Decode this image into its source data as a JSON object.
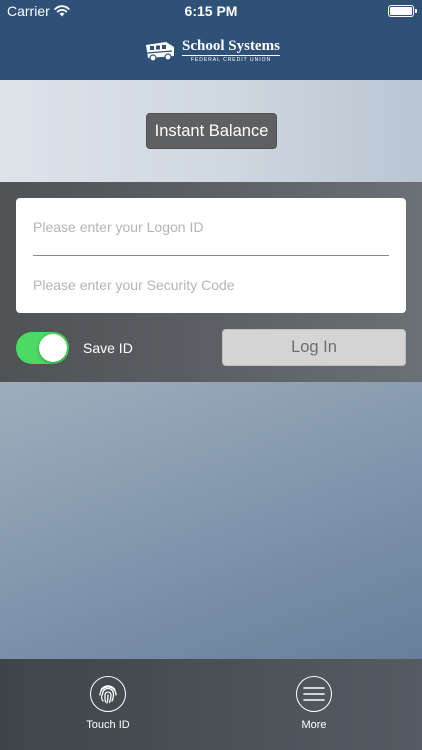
{
  "status_bar": {
    "carrier": "Carrier",
    "time": "6:15 PM"
  },
  "header": {
    "logo_name": "School Systems",
    "logo_sub": "FEDERAL CREDIT UNION",
    "background_color": "#2f5178"
  },
  "balance": {
    "button_label": "Instant Balance"
  },
  "login": {
    "logon_placeholder": "Please enter your Logon ID",
    "logon_value": "",
    "security_placeholder": "Please enter your Security Code",
    "security_value": "",
    "save_id_label": "Save ID",
    "save_id_on": true,
    "toggle_color": "#4cd964",
    "login_button_label": "Log In"
  },
  "tab_bar": {
    "items": [
      {
        "label": "Touch ID",
        "icon": "fingerprint-icon"
      },
      {
        "label": "More",
        "icon": "menu-icon"
      }
    ]
  }
}
